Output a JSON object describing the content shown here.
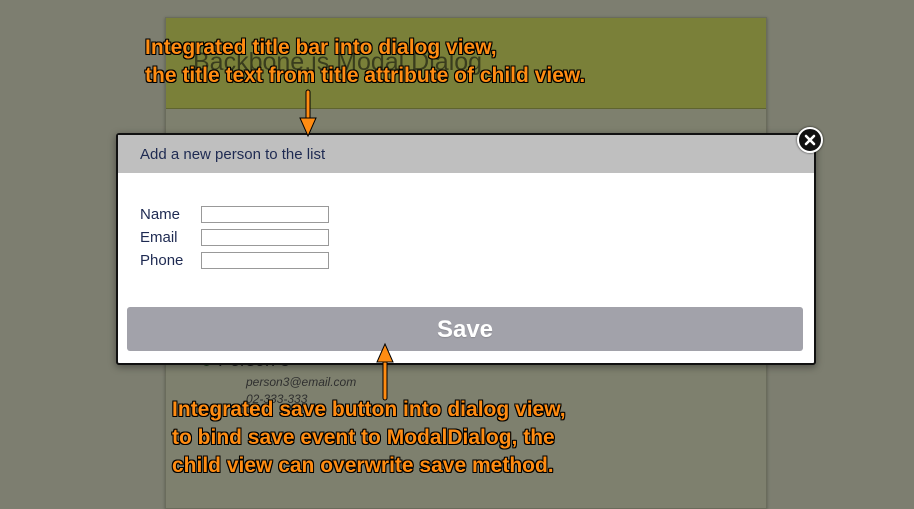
{
  "background_page": {
    "title": "Backbone.js Modal Dialog",
    "person": {
      "name": "Person 3",
      "email": "person3@email.com",
      "phone": "02-333-333"
    }
  },
  "dialog": {
    "title": "Add a new person to the list",
    "fields": [
      {
        "label": "Name",
        "value": ""
      },
      {
        "label": "Email",
        "value": ""
      },
      {
        "label": "Phone",
        "value": ""
      }
    ],
    "save_label": "Save",
    "close_icon": "close-icon"
  },
  "annotations": {
    "top": {
      "line1": "Integrated title bar into dialog view,",
      "line2": "the title text from title attribute of  child view."
    },
    "bottom": {
      "line1": "Integrated save button into dialog view,",
      "line2": "to bind save event to ModalDialog, the",
      "line3": "child view can overwrite save method."
    }
  },
  "colors": {
    "annotation": "#ff8c12",
    "page_background": "#7d7e70",
    "header_background": "#7a8039",
    "dialog_titlebar": "#bfbfbf",
    "save_button": "#a2a2aa"
  }
}
